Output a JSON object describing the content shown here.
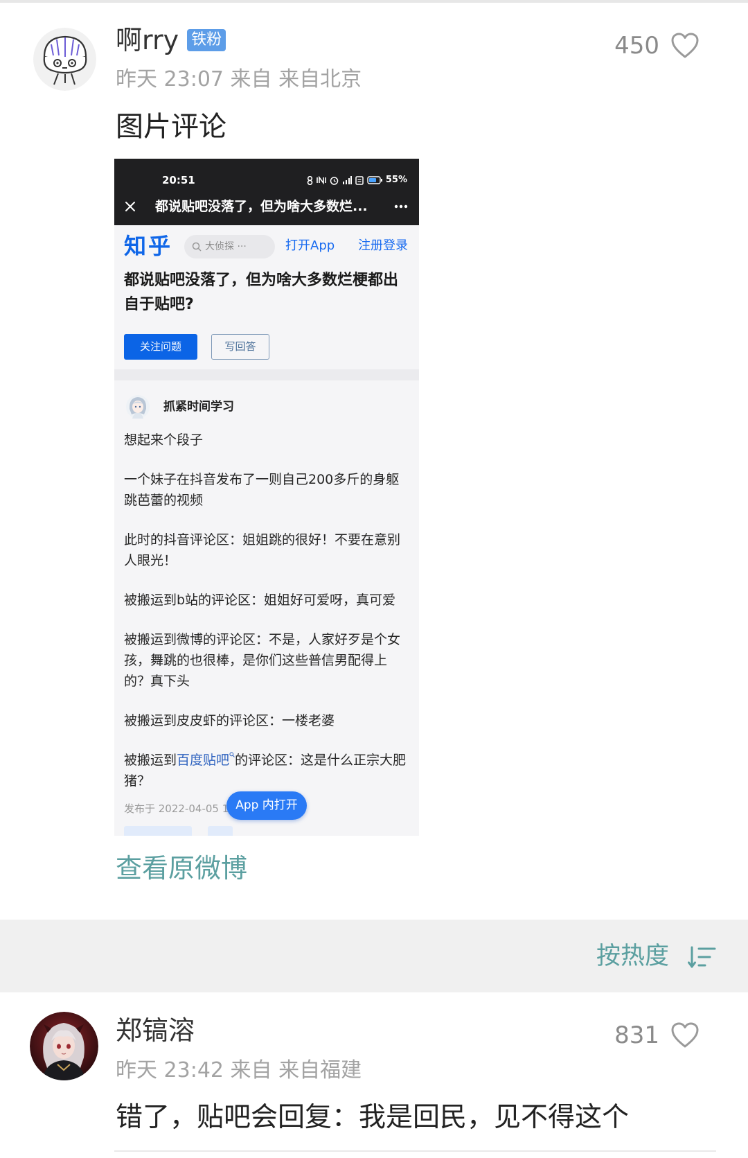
{
  "page": {
    "accent_color": "#5b9fa0",
    "badge_color": "#5d9de8",
    "like_icon": "heart-icon"
  },
  "top_comment": {
    "avatar": "doodle-avatar",
    "username": "啊rry",
    "badge": "铁粉",
    "meta": "昨天 23:07 来自 来自北京",
    "likes": "450",
    "text": "图片评论",
    "view_original": "查看原微博",
    "image": {
      "status_bar": {
        "time": "20:51",
        "battery": "55%",
        "icons": [
          "vibrate-icon",
          "nfc-icon",
          "alarm-icon",
          "signal-icon",
          "message-icon",
          "battery-icon"
        ]
      },
      "nav": {
        "title": "都说贴吧没落了，但为啥大多数烂...",
        "icons": [
          "close-icon",
          "more-icon"
        ]
      },
      "zhihu_bar": {
        "logo": "知乎",
        "search_placeholder": "大侦探 ···",
        "open_app": "打开App",
        "login": "注册登录"
      },
      "question_title": [
        "都说贴吧没落了，但为啥大多数烂梗都出",
        "自于贴吧?"
      ],
      "follow_button": "关注问题",
      "answer_button": "写回答",
      "answer": {
        "author": "抓紧时间学习",
        "paragraphs": [
          [
            "想起来个段子"
          ],
          [
            "一个妹子在抖音发布了一则自己200多斤的身躯",
            "跳芭蕾的视频"
          ],
          [
            "此时的抖音评论区：姐姐跳的很好！不要在意别",
            "人眼光！"
          ],
          [
            "被搬运到b站的评论区：姐姐好可爱呀，真可爱"
          ],
          [
            "被搬运到微博的评论区：不是，人家好歹是个女",
            "孩，舞跳的也很棒，是你们这些普信男配得上",
            "的？真下头"
          ],
          [
            "被搬运到皮皮虾的评论区：一楼老婆"
          ]
        ],
        "last_paragraph": {
          "prefix": "被搬运到",
          "link": "百度贴吧",
          "suffix": "的评论区：这是什么正宗大肥",
          "line2": "猪？"
        },
        "published": "发布于 2022-04-05 19"
      },
      "open_in_app": "App 内打开",
      "link_color": "#1a6cf0"
    }
  },
  "sort_bar": {
    "label": "按热度",
    "icon": "sort-icon"
  },
  "replies": [
    {
      "avatar": "anime-avatar",
      "username": "郑镐溶",
      "meta": "昨天 23:42 来自 来自福建",
      "likes": "831",
      "text": "错了，贴吧会回复：我是回民，见不得这个"
    }
  ]
}
